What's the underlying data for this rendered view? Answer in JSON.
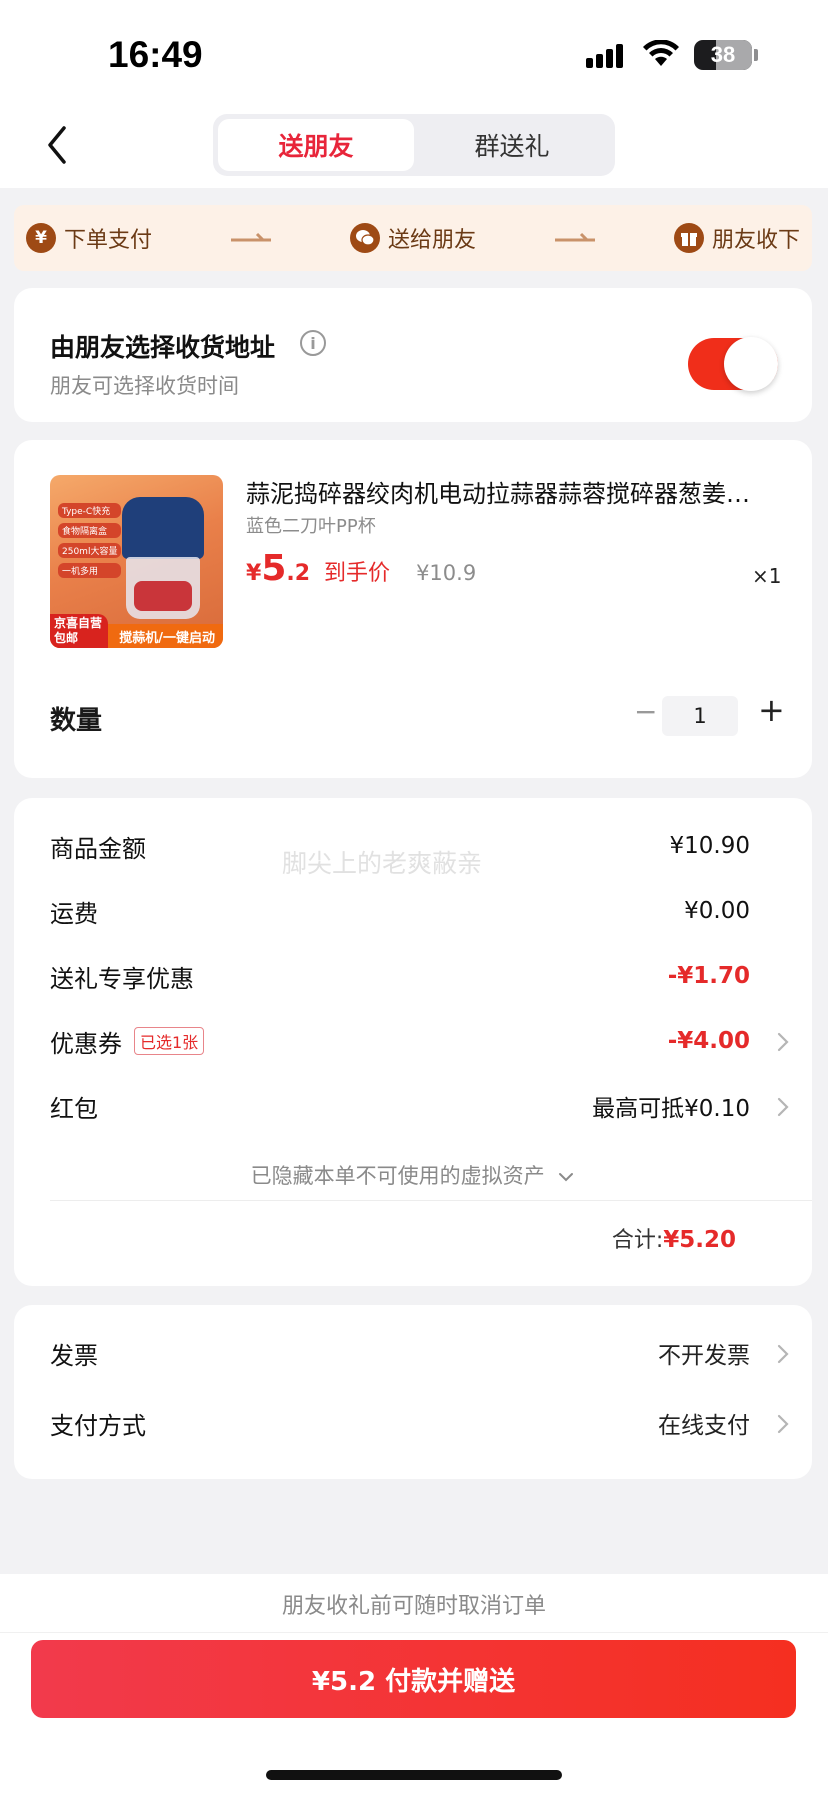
{
  "status_bar": {
    "time": "16:49",
    "battery": "38"
  },
  "header": {
    "tabs": [
      {
        "label": "送朋友",
        "active": true
      },
      {
        "label": "群送礼",
        "active": false
      }
    ]
  },
  "flow": {
    "steps": [
      {
        "label": "下单支付",
        "icon": "yen-icon"
      },
      {
        "label": "送给朋友",
        "icon": "wechat-icon"
      },
      {
        "label": "朋友收下",
        "icon": "gift-icon"
      }
    ]
  },
  "address": {
    "title": "由朋友选择收货地址",
    "subtitle": "朋友可选择收货时间",
    "toggle_on": true
  },
  "product": {
    "title": "蒜泥捣碎器绞肉机电动拉蒜器蒜蓉搅碎器葱姜…",
    "spec": "蓝色二刀叶PP杯",
    "price_yen": "¥",
    "price_int": "5",
    "price_dec": ".2",
    "price_tag": "到手价",
    "original_price": "¥10.9",
    "count_label": "×1",
    "thumb": {
      "tags": [
        "Type-C快充",
        "食物隔离盒",
        "250ml大容量",
        "一机多用"
      ],
      "badge_line1": "京喜自营",
      "badge_line2": "包邮",
      "footer": "搅蒜机/一键启动"
    },
    "quantity_label": "数量",
    "quantity": "1",
    "minus": "−",
    "plus": "+"
  },
  "detail": {
    "watermark": "脚尖上的老爽蔽亲",
    "rows": [
      {
        "label": "商品金额",
        "value": "¥10.90"
      },
      {
        "label": "运费",
        "value": "¥0.00"
      },
      {
        "label": "送礼专享优惠",
        "value": "-¥1.70"
      },
      {
        "label": "优惠券",
        "chip": "已选1张",
        "value": "-¥4.00"
      },
      {
        "label": "红包",
        "value": "最高可抵¥0.10"
      }
    ],
    "hidden_note": "已隐藏本单不可使用的虚拟资产",
    "total_label": "合计:",
    "total_value": "¥5.20"
  },
  "invoice": {
    "rows": [
      {
        "label": "发票",
        "value": "不开发票"
      },
      {
        "label": "支付方式",
        "value": "在线支付"
      }
    ]
  },
  "bottom": {
    "note": "朋友收礼前可随时取消订单",
    "pay_button": "¥5.2 付款并赠送"
  },
  "colors": {
    "accent": "#e52a2a",
    "flow_bg": "#fdf1e7",
    "flow_icon": "#9e4a15",
    "toggle": "#f02e1a"
  }
}
